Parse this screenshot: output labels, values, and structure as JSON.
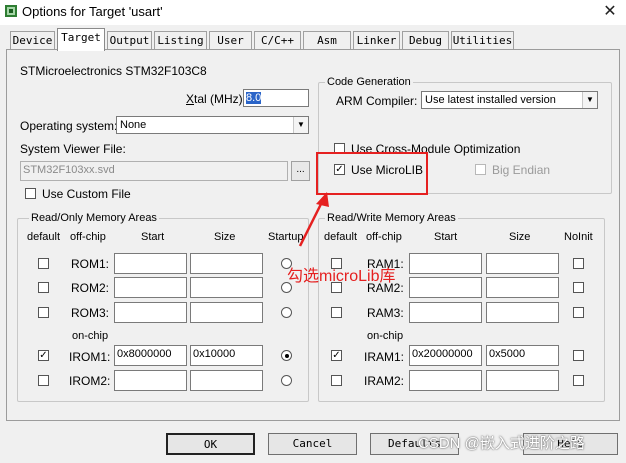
{
  "window": {
    "title": "Options for Target 'usart'",
    "close_glyph": "✕"
  },
  "tabs": [
    {
      "label": "Device"
    },
    {
      "label": "Target"
    },
    {
      "label": "Output"
    },
    {
      "label": "Listing"
    },
    {
      "label": "User"
    },
    {
      "label": "C/C++"
    },
    {
      "label": "Asm"
    },
    {
      "label": "Linker"
    },
    {
      "label": "Debug"
    },
    {
      "label": "Utilities"
    }
  ],
  "target": {
    "device_name": "STMicroelectronics STM32F103C8",
    "xtal_label_pre": "X",
    "xtal_label_rest": "tal (MHz):",
    "xtal_value": "8.0",
    "os_label": "Operating system:",
    "os_value": "None",
    "svf_label": "System Viewer File:",
    "svf_value": "STM32F103xx.svd",
    "svf_browse": "...",
    "custom_file_label": "Use Custom File"
  },
  "codegen": {
    "group_title": "Code Generation",
    "compiler_label": "ARM Compiler:",
    "compiler_value": "Use latest installed version",
    "cross_module_label": "Use Cross-Module Optimization",
    "microlib_label": "Use MicroLIB",
    "microlib_checked": true,
    "big_endian_label": "Big Endian"
  },
  "ro_memory": {
    "group_title": "Read/Only Memory Areas",
    "headers": {
      "default": "default",
      "offchip": "off-chip",
      "start": "Start",
      "size": "Size",
      "startup": "Startup"
    },
    "onchip_label": "on-chip",
    "rows": [
      {
        "name": "ROM1:",
        "start": "",
        "size": "",
        "default": false,
        "startup": false
      },
      {
        "name": "ROM2:",
        "start": "",
        "size": "",
        "default": false,
        "startup": false
      },
      {
        "name": "ROM3:",
        "start": "",
        "size": "",
        "default": false,
        "startup": false
      },
      {
        "name": "IROM1:",
        "start": "0x8000000",
        "size": "0x10000",
        "default": true,
        "startup": true
      },
      {
        "name": "IROM2:",
        "start": "",
        "size": "",
        "default": false,
        "startup": false
      }
    ]
  },
  "rw_memory": {
    "group_title": "Read/Write Memory Areas",
    "headers": {
      "default": "default",
      "offchip": "off-chip",
      "start": "Start",
      "size": "Size",
      "noinit": "NoInit"
    },
    "onchip_label": "on-chip",
    "rows": [
      {
        "name": "RAM1:",
        "start": "",
        "size": "",
        "default": false,
        "noinit": false
      },
      {
        "name": "RAM2:",
        "start": "",
        "size": "",
        "default": false,
        "noinit": false
      },
      {
        "name": "RAM3:",
        "start": "",
        "size": "",
        "default": false,
        "noinit": false
      },
      {
        "name": "IRAM1:",
        "start": "0x20000000",
        "size": "0x5000",
        "default": true,
        "noinit": false
      },
      {
        "name": "IRAM2:",
        "start": "",
        "size": "",
        "default": false,
        "noinit": false
      }
    ]
  },
  "buttons": {
    "ok": "OK",
    "cancel": "Cancel",
    "defaults": "Defaults",
    "help": "Help"
  },
  "annotation": {
    "text": "勾选microLib库",
    "color": "#e52020"
  },
  "watermark": {
    "text": "CSDN @嵌入式进阶之路"
  }
}
